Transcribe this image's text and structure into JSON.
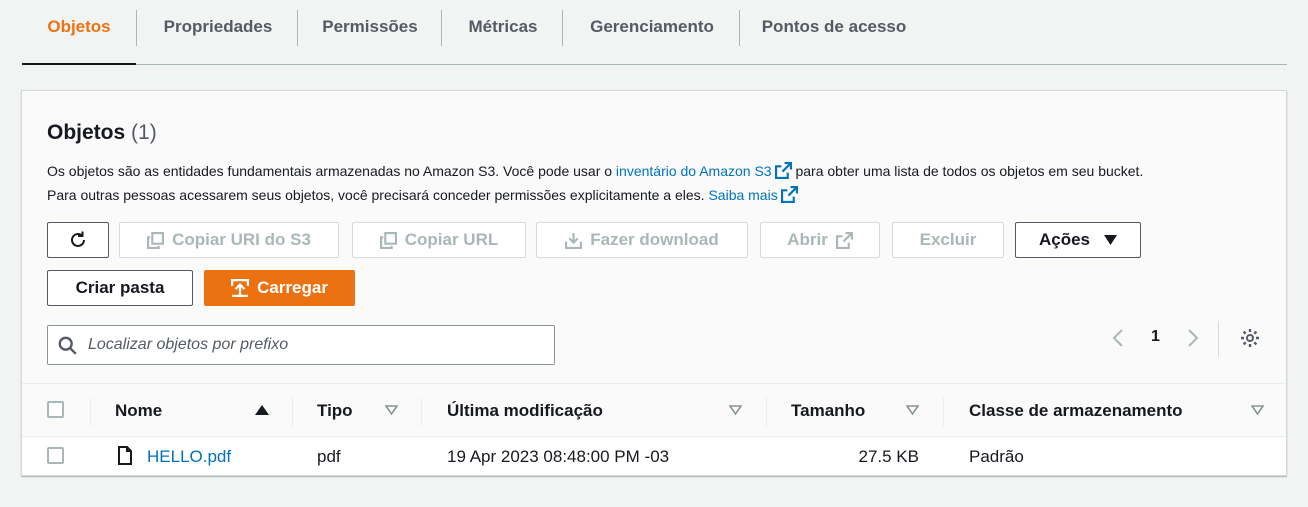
{
  "tabs": [
    {
      "label": "Objetos",
      "active": true
    },
    {
      "label": "Propriedades"
    },
    {
      "label": "Permissões"
    },
    {
      "label": "Métricas"
    },
    {
      "label": "Gerenciamento"
    },
    {
      "label": "Pontos de acesso"
    }
  ],
  "panel": {
    "title": "Objetos",
    "count": "(1)",
    "desc1_pre": "Os objetos são as entidades fundamentais armazenadas no Amazon S3. Você pode usar o ",
    "desc1_link": "inventário do Amazon S3",
    "desc1_post": " para obter uma lista de todos os objetos em seu bucket.",
    "desc2_pre": "Para outras pessoas acessarem seus objetos, você precisará conceder permissões explicitamente a eles. ",
    "desc2_link": "Saiba mais"
  },
  "toolbar": {
    "copy_uri": "Copiar URI do S3",
    "copy_url": "Copiar URL",
    "download": "Fazer download",
    "open": "Abrir",
    "delete": "Excluir",
    "actions": "Ações",
    "create_folder": "Criar pasta",
    "upload": "Carregar"
  },
  "search": {
    "placeholder": "Localizar objetos por prefixo",
    "value": ""
  },
  "pagination": {
    "page": "1"
  },
  "table": {
    "columns": [
      "Nome",
      "Tipo",
      "Última modificação",
      "Tamanho",
      "Classe de armazenamento"
    ],
    "rows": [
      {
        "name": "HELLO.pdf",
        "type": "pdf",
        "modified": "19 Apr 2023 08:48:00 PM -03",
        "size": "27.5 KB",
        "class": "Padrão"
      }
    ]
  },
  "colors": {
    "accent": "#ec7211",
    "link": "#0073bb",
    "text": "#16191f",
    "muted": "#545b64",
    "disabled": "#aab7b8"
  }
}
